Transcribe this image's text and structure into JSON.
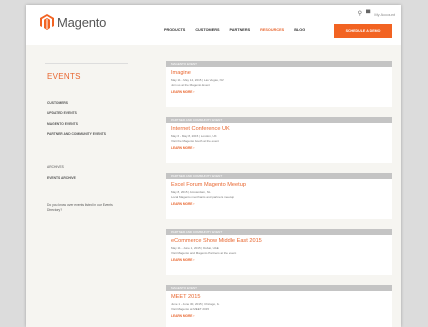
{
  "header": {
    "logo_text": "Magento",
    "top_icons": {
      "search": "search-icon",
      "cart": "cart-icon",
      "account_label": "My Account"
    },
    "nav": [
      "PRODUCTS",
      "CUSTOMERS",
      "PARTNERS",
      "RESOURCES",
      "BLOG"
    ],
    "cta_label": "SCHEDULE A DEMO"
  },
  "sidebar": {
    "title": "EVENTS",
    "links": [
      "CUSTOMERS",
      "UPDATED EVENTS",
      "MAGENTO EVENTS",
      "PARTNER AND COMMUNITY EVENTS"
    ],
    "archive_heading": "ARCHIVES",
    "archive_link": "EVENTS ARCHIVE",
    "note": "Do you know over events listed in our Events Directory?"
  },
  "events": [
    {
      "bar": "MAGENTO EVENT",
      "title": "Imagine",
      "lines": [
        "May 11 - May 14, 2015 | Las Vegas, NV",
        "Join us at the Magento Event"
      ],
      "more": "LEARN MORE"
    },
    {
      "bar": "PARTNER AND COMMUNITY EVENT",
      "title": "Internet Conference UK",
      "lines": [
        "May 6 - May 8, 2015 | London, UK",
        "Visit the Magento booth at the event"
      ],
      "more": "LEARN MORE"
    },
    {
      "bar": "PARTNER AND COMMUNITY EVENT",
      "title": "Excel Forum Magento Meetup",
      "lines": [
        "May 8, 2015 | Amsterdam, NL",
        "Local Magento merchants and partners meetup"
      ],
      "more": "LEARN MORE"
    },
    {
      "bar": "PARTNER AND COMMUNITY EVENT",
      "title": "eCommerce Show Middle East 2015",
      "lines": [
        "May 11 - June 1, 2015 | Dubai, UAE",
        "Visit Magento and Magento Partners at the event"
      ],
      "more": "LEARN MORE"
    },
    {
      "bar": "MAGENTO EVENT",
      "title": "MEET 2015",
      "lines": [
        "June 1 - June 30, 2015 | Chicago, IL",
        "Visit Magento at MEET 2015"
      ],
      "more": "LEARN MORE"
    }
  ]
}
